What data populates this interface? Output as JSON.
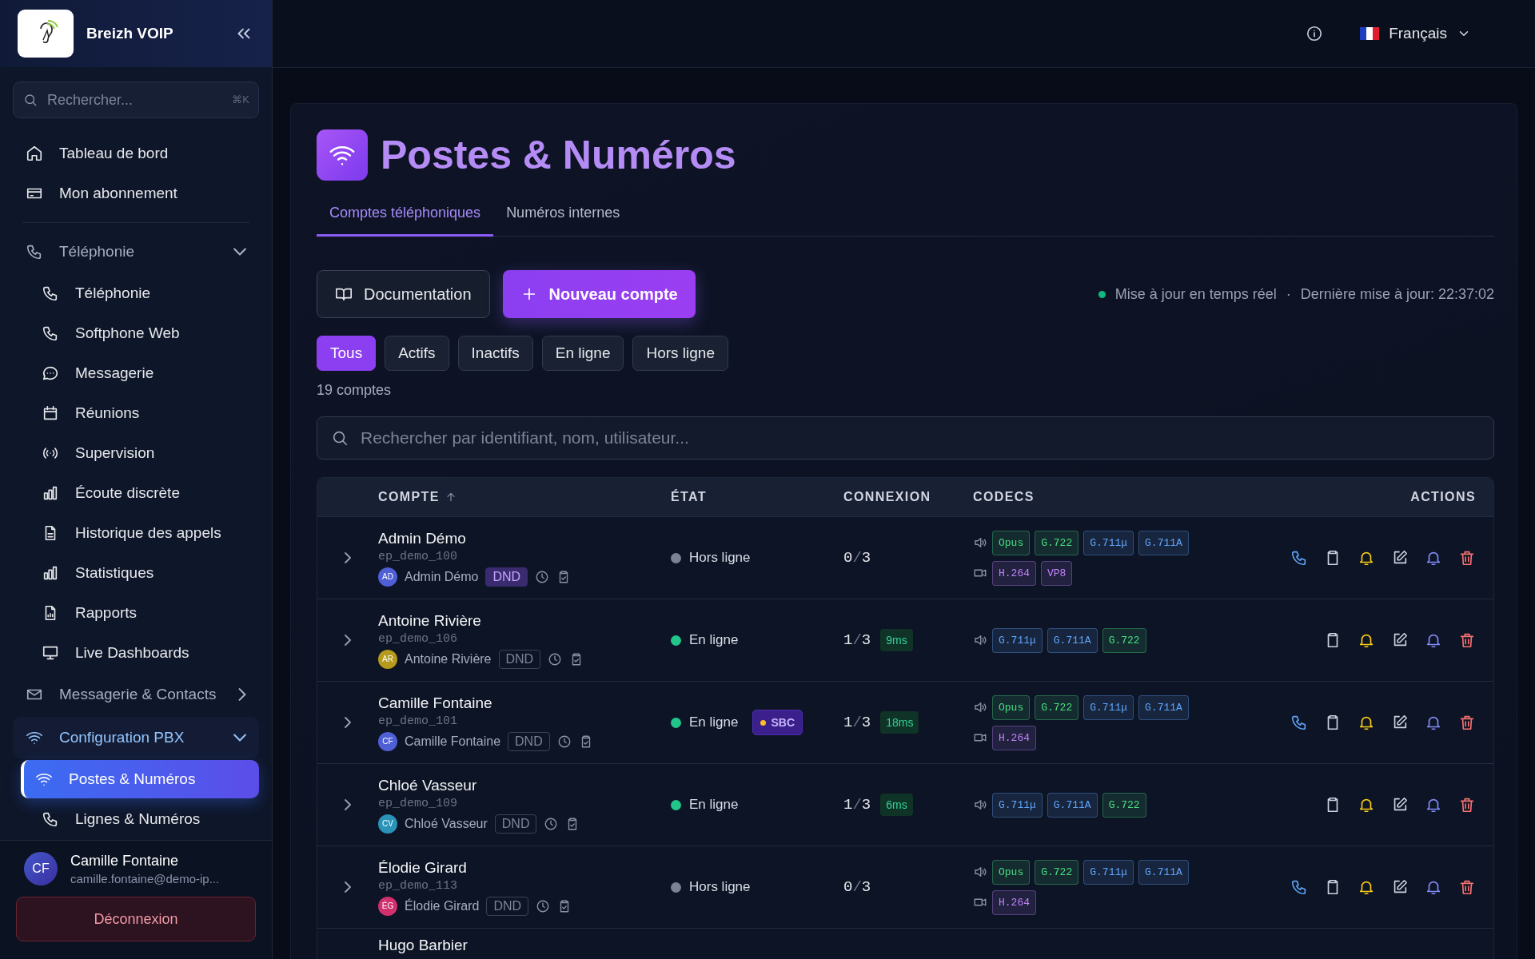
{
  "sidebar": {
    "brand": "Breizh VOIP",
    "search": {
      "placeholder": "Rechercher...",
      "shortcut": "⌘K"
    },
    "nav": [
      {
        "kind": "link",
        "label": "Tableau de bord"
      },
      {
        "kind": "link",
        "label": "Mon abonnement"
      },
      {
        "kind": "group",
        "label": "Téléphonie",
        "expanded": true,
        "children": [
          {
            "label": "Téléphonie",
            "selected": false
          },
          {
            "label": "Softphone Web",
            "selected": false
          },
          {
            "label": "Messagerie",
            "selected": false
          },
          {
            "label": "Réunions",
            "selected": false
          },
          {
            "label": "Supervision",
            "selected": false
          },
          {
            "label": "Écoute discrète",
            "selected": false
          },
          {
            "label": "Historique des appels",
            "selected": false
          },
          {
            "label": "Statistiques",
            "selected": false
          },
          {
            "label": "Rapports",
            "selected": false
          },
          {
            "label": "Live Dashboards",
            "selected": false
          }
        ]
      },
      {
        "kind": "group",
        "label": "Messagerie & Contacts",
        "expanded": false
      },
      {
        "kind": "group",
        "label": "Configuration PBX",
        "expanded": true,
        "children": [
          {
            "label": "Postes & Numéros",
            "selected": true
          },
          {
            "label": "Lignes & Numéros",
            "selected": false
          }
        ]
      }
    ],
    "user": {
      "initials": "CF",
      "name": "Camille Fontaine",
      "email": "camille.fontaine@demo-ip..."
    },
    "logout": "Déconnexion"
  },
  "topbar": {
    "language": "Français"
  },
  "page": {
    "title": "Postes & Numéros",
    "tabs": [
      {
        "label": "Comptes téléphoniques",
        "selected": true
      },
      {
        "label": "Numéros internes",
        "selected": false
      }
    ],
    "buttons": [
      {
        "kind": "secondary",
        "label": "Documentation"
      },
      {
        "kind": "primary",
        "label": "Nouveau compte"
      }
    ],
    "live": {
      "label": "Mise à jour en temps réel",
      "separator": "·",
      "last_update": "Dernière mise à jour: 22:37:02"
    },
    "filters": [
      {
        "label": "Tous",
        "selected": true
      },
      {
        "label": "Actifs",
        "selected": false
      },
      {
        "label": "Inactifs",
        "selected": false
      },
      {
        "label": "En ligne",
        "selected": false
      },
      {
        "label": "Hors ligne",
        "selected": false
      }
    ],
    "count": "19 comptes",
    "search": {
      "placeholder": "Rechercher par identifiant, nom, utilisateur..."
    }
  },
  "table": {
    "columns": [
      {
        "label": "COMPTE",
        "sorted": true
      },
      {
        "label": "ÉTAT",
        "sorted": false
      },
      {
        "label": "CONNEXION",
        "sorted": false
      },
      {
        "label": "CODECS",
        "sorted": false
      },
      {
        "label": "ACTIONS",
        "sorted": false
      }
    ],
    "rows": [
      {
        "name": "Admin Démo",
        "endpoint": "ep_demo_100",
        "initials": "AD",
        "color": "#4f5fd6",
        "user": "Admin Démo",
        "dnd_label": "DND",
        "dnd": true,
        "online": false,
        "status": "Hors ligne",
        "connection": [
          "0",
          "/",
          "3"
        ],
        "audio": [
          {
            "label": "Opus",
            "color": "#4ade80"
          },
          {
            "label": "G.722",
            "color": "#4ade80"
          },
          {
            "label": "G.711μ",
            "color": "#60a5fa"
          },
          {
            "label": "G.711A",
            "color": "#60a5fa"
          }
        ],
        "video": [
          {
            "label": "H.264",
            "color": "#c084fc"
          },
          {
            "label": "VP8",
            "color": "#c084fc"
          }
        ],
        "callable": true
      },
      {
        "name": "Antoine Rivière",
        "endpoint": "ep_demo_106",
        "initials": "AR",
        "color": "#b59a1c",
        "user": "Antoine Rivière",
        "dnd_label": "DND",
        "dnd": false,
        "online": true,
        "status": "En ligne",
        "connection": [
          "1",
          "/",
          "3"
        ],
        "latency": "9ms",
        "audio": [
          {
            "label": "G.711μ",
            "color": "#60a5fa"
          },
          {
            "label": "G.711A",
            "color": "#60a5fa"
          },
          {
            "label": "G.722",
            "color": "#4ade80"
          }
        ],
        "callable": false
      },
      {
        "name": "Camille Fontaine",
        "endpoint": "ep_demo_101",
        "initials": "CF",
        "color": "#4f5fd6",
        "user": "Camille Fontaine",
        "dnd_label": "DND",
        "dnd": false,
        "online": true,
        "status": "En ligne",
        "badge": "SBC",
        "connection": [
          "1",
          "/",
          "3"
        ],
        "latency": "18ms",
        "audio": [
          {
            "label": "Opus",
            "color": "#4ade80"
          },
          {
            "label": "G.722",
            "color": "#4ade80"
          },
          {
            "label": "G.711μ",
            "color": "#60a5fa"
          },
          {
            "label": "G.711A",
            "color": "#60a5fa"
          }
        ],
        "video": [
          {
            "label": "H.264",
            "color": "#c084fc"
          }
        ],
        "callable": true
      },
      {
        "name": "Chloé Vasseur",
        "endpoint": "ep_demo_109",
        "initials": "CV",
        "color": "#2a93b8",
        "user": "Chloé Vasseur",
        "dnd_label": "DND",
        "dnd": false,
        "online": true,
        "status": "En ligne",
        "connection": [
          "1",
          "/",
          "3"
        ],
        "latency": "6ms",
        "audio": [
          {
            "label": "G.711μ",
            "color": "#60a5fa"
          },
          {
            "label": "G.711A",
            "color": "#60a5fa"
          },
          {
            "label": "G.722",
            "color": "#4ade80"
          }
        ],
        "callable": false
      },
      {
        "name": "Élodie Girard",
        "endpoint": "ep_demo_113",
        "initials": "ÉG",
        "color": "#d0306e",
        "user": "Élodie Girard",
        "dnd_label": "DND",
        "dnd": false,
        "online": false,
        "status": "Hors ligne",
        "connection": [
          "0",
          "/",
          "3"
        ],
        "audio": [
          {
            "label": "Opus",
            "color": "#4ade80"
          },
          {
            "label": "G.722",
            "color": "#4ade80"
          },
          {
            "label": "G.711μ",
            "color": "#60a5fa"
          },
          {
            "label": "G.711A",
            "color": "#60a5fa"
          }
        ],
        "video": [
          {
            "label": "H.264",
            "color": "#c084fc"
          }
        ],
        "callable": true
      },
      {
        "name": "Hugo Barbier"
      }
    ]
  }
}
